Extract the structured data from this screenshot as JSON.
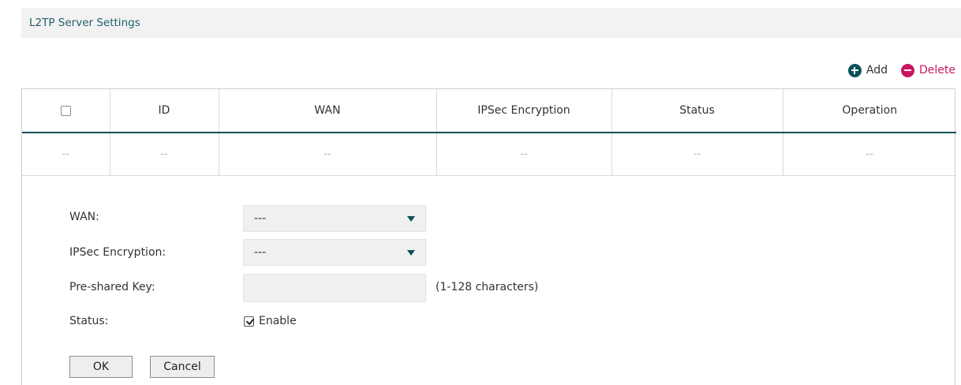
{
  "section": {
    "title": "L2TP Server Settings"
  },
  "toolbar": {
    "add_label": "Add",
    "delete_label": "Delete"
  },
  "table": {
    "headers": [
      "",
      "ID",
      "WAN",
      "IPSec Encryption",
      "Status",
      "Operation"
    ],
    "rows": [
      [
        "--",
        "--",
        "--",
        "--",
        "--",
        "--"
      ]
    ]
  },
  "form": {
    "wan_label": "WAN:",
    "wan_value": "---",
    "ipsec_label": "IPSec Encryption:",
    "ipsec_value": "---",
    "psk_label": "Pre-shared Key:",
    "psk_value": "",
    "psk_hint": "(1-128 characters)",
    "status_label": "Status:",
    "status_enable_label": "Enable",
    "status_enabled": true,
    "ok_label": "OK",
    "cancel_label": "Cancel"
  },
  "colors": {
    "accent": "#0d4f5b",
    "delete": "#c91663",
    "field_bg": "#f0f0f0"
  }
}
